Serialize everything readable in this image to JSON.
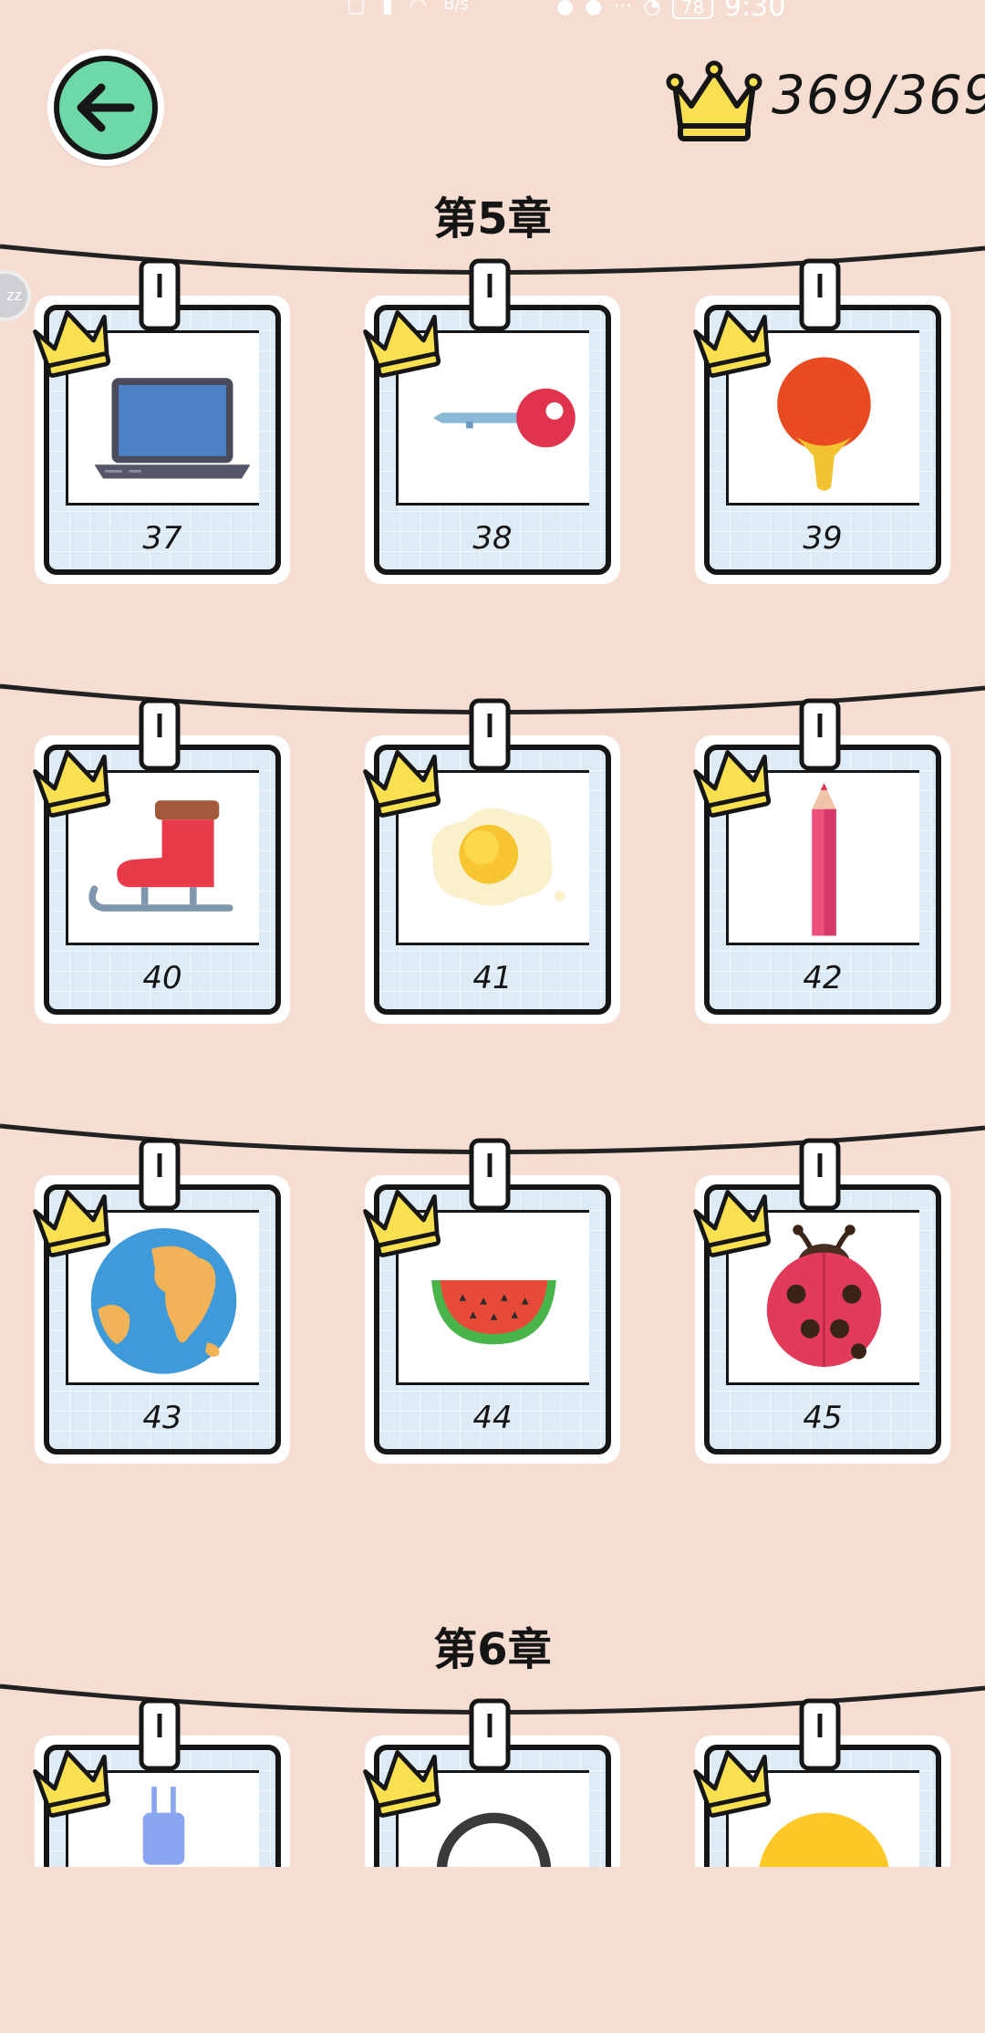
{
  "status_bar": {
    "left_icons": [
      "hd-icon",
      "signal-icon",
      "wifi-icon"
    ],
    "speed_unit": "B/s",
    "battery": "78",
    "time": "9:30"
  },
  "header": {
    "score": "369/369"
  },
  "chapters": [
    {
      "title": "第5章",
      "rows": [
        [
          {
            "number": "37",
            "icon": "laptop-icon"
          },
          {
            "number": "38",
            "icon": "key-icon"
          },
          {
            "number": "39",
            "icon": "ping-pong-paddle-icon"
          }
        ],
        [
          {
            "number": "40",
            "icon": "ice-skate-icon"
          },
          {
            "number": "41",
            "icon": "fried-egg-icon"
          },
          {
            "number": "42",
            "icon": "pencil-icon"
          }
        ],
        [
          {
            "number": "43",
            "icon": "earth-globe-icon"
          },
          {
            "number": "44",
            "icon": "watermelon-icon"
          },
          {
            "number": "45",
            "icon": "ladybug-icon"
          }
        ]
      ]
    },
    {
      "title": "第6章",
      "rows": [
        [
          {
            "number": "",
            "icon": "plug-icon"
          },
          {
            "number": "",
            "icon": "ring-icon"
          },
          {
            "number": "",
            "icon": "sun-icon"
          }
        ]
      ]
    }
  ],
  "colors": {
    "background": "#f6ddd2",
    "card_panel": "#dcebf6",
    "back_button": "#6fd8a8",
    "crown": "#f8e050"
  }
}
